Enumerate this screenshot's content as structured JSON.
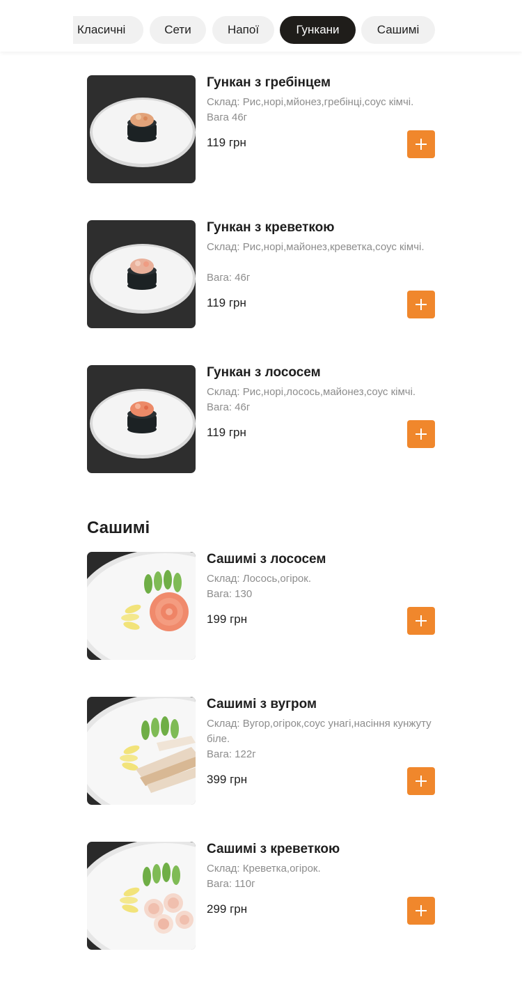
{
  "categories": [
    {
      "label": "Класичні",
      "active": false
    },
    {
      "label": "Сети",
      "active": false
    },
    {
      "label": "Напої",
      "active": false
    },
    {
      "label": "Гункани",
      "active": true
    },
    {
      "label": "Сашимі",
      "active": false
    }
  ],
  "colors": {
    "accent": "#f0872c",
    "active_pill": "#1f1d1a",
    "pill": "#f1f1f1"
  },
  "sections": [
    {
      "title": "",
      "items": [
        {
          "name": "Гункан з гребінцем",
          "description": "Склад: Рис,норі,мйонез,гребінці,соус кімчі.",
          "weight": "Вага 46г",
          "price": "119 грн",
          "image": "gunkan-scallop-image"
        },
        {
          "name": "Гункан з креветкою",
          "description": "Склад: Рис,норі,майонез,креветка,соус кімчі.",
          "weight": "Вага: 46г",
          "price": "119 грн",
          "image": "gunkan-shrimp-image"
        },
        {
          "name": "Гункан з лососем",
          "description": "Склад: Рис,норі,лосось,майонез,соус кімчі.",
          "weight": "Вага: 46г",
          "price": "119 грн",
          "image": "gunkan-salmon-image"
        }
      ]
    },
    {
      "title": "Сашимі",
      "items": [
        {
          "name": "Сашимі з лососем",
          "description": "Склад: Лосось,огірок.",
          "weight": "Вага: 130",
          "price": "199 грн",
          "image": "sashimi-salmon-image"
        },
        {
          "name": "Сашимі з вугром",
          "description": "Склад: Вугор,огірок,соус унагі,насіння кунжуту біле.",
          "weight": "Вага: 122г",
          "price": "399 грн",
          "image": "sashimi-eel-image"
        },
        {
          "name": "Сашимі з креветкою",
          "description": "Склад: Креветка,огірок.",
          "weight": "Вага: 110г",
          "price": "299 грн",
          "image": "sashimi-shrimp-image"
        }
      ]
    }
  ],
  "add_icon": "plus-icon"
}
